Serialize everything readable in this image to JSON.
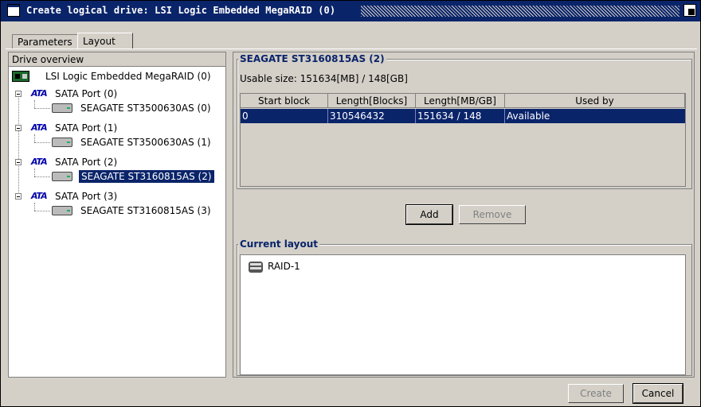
{
  "window": {
    "title": "Create logical drive: LSI Logic Embedded MegaRAID (0)"
  },
  "tabs": [
    {
      "label": "Parameters",
      "selected": false
    },
    {
      "label": "Layout",
      "selected": true
    }
  ],
  "drive_overview": {
    "header": "Drive overview",
    "controller": "LSI Logic Embedded MegaRAID (0)",
    "ports": [
      {
        "label": "SATA Port (0)",
        "drive": "SEAGATE ST3500630AS (0)"
      },
      {
        "label": "SATA Port (1)",
        "drive": "SEAGATE ST3500630AS (1)"
      },
      {
        "label": "SATA Port (2)",
        "drive": "SEAGATE ST3160815AS (2)",
        "selected": true
      },
      {
        "label": "SATA Port (3)",
        "drive": "SEAGATE ST3160815AS (3)"
      }
    ],
    "ata_label": "ATA"
  },
  "drive_details": {
    "title": "SEAGATE ST3160815AS (2)",
    "usable_size": "Usable size: 151634[MB] / 148[GB]",
    "columns": [
      "Start block",
      "Length[Blocks]",
      "Length[MB/GB]",
      "Used by"
    ],
    "rows": [
      {
        "start": "0",
        "length_blocks": "310546432",
        "length_mb_gb": "151634 / 148",
        "used_by": "Available"
      }
    ]
  },
  "actions": {
    "add": "Add",
    "remove": "Remove"
  },
  "current_layout": {
    "title": "Current layout",
    "items": [
      "RAID-1"
    ]
  },
  "footer": {
    "create": "Create",
    "cancel": "Cancel"
  },
  "colors": {
    "selection": "#0a246a",
    "title_text": "#0a246a",
    "background": "#d4d0c8"
  }
}
